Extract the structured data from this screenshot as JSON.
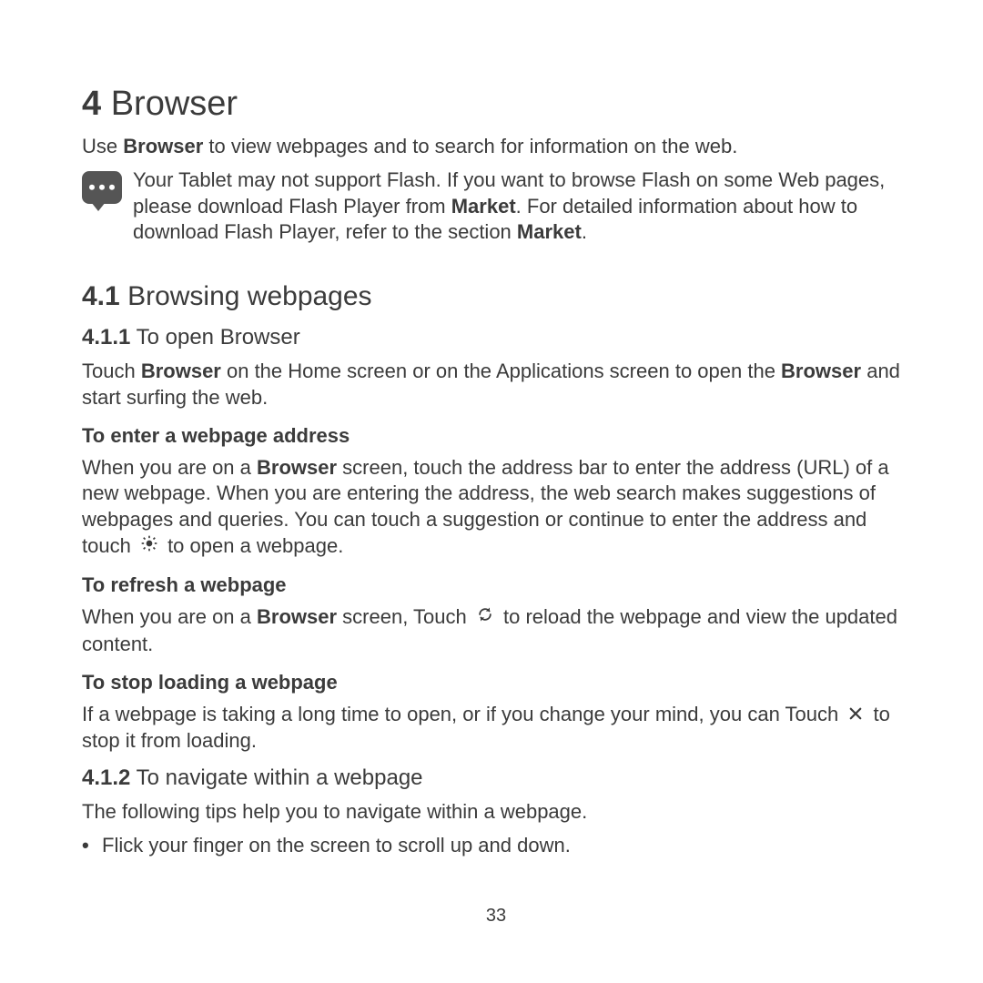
{
  "chapter": {
    "num": "4",
    "title": "Browser"
  },
  "intro": {
    "pre": "Use ",
    "bold": "Browser",
    "post": " to view webpages and to search for information on the web."
  },
  "note": {
    "t1": "Your Tablet may not support Flash. If you want to browse Flash on some Web pages, please download Flash Player from ",
    "m1": "Market",
    "t2": ". For detailed information about how to download Flash Player, refer to the section ",
    "m2": "Market",
    "t3": "."
  },
  "s41": {
    "num": "4.1",
    "title": "Browsing webpages"
  },
  "s411": {
    "num": "4.1.1",
    "title": "To open Browser"
  },
  "p411": {
    "a": "Touch ",
    "b1": "Browser",
    "b": " on the Home screen or on the Applications screen to open the ",
    "b2": "Browser",
    "c": " and start surfing the web."
  },
  "h_enter": "To enter a webpage address",
  "p_enter": {
    "a": "When you are on a ",
    "b1": "Browser",
    "b": " screen, touch the address bar to enter the address (URL) of a new webpage. When you are entering the address, the web search makes suggestions of webpages and queries. You can touch a suggestion or continue to enter the address and touch ",
    "c": " to open a webpage."
  },
  "h_refresh": "To refresh a webpage",
  "p_refresh": {
    "a": "When you are on a ",
    "b1": "Browser",
    "b": " screen, Touch ",
    "c": " to reload the webpage and view the updated content."
  },
  "h_stop": "To stop loading a webpage",
  "p_stop": {
    "a": "If a webpage is taking a long time to open, or if you change your mind, you can Touch ",
    "c": " to stop it from loading."
  },
  "s412": {
    "num": "4.1.2",
    "title": "To navigate within a webpage"
  },
  "p412_lead": "The following tips help you to navigate within a webpage.",
  "bullet1": "Flick your finger on the screen to scroll up and down.",
  "page_number": "33"
}
